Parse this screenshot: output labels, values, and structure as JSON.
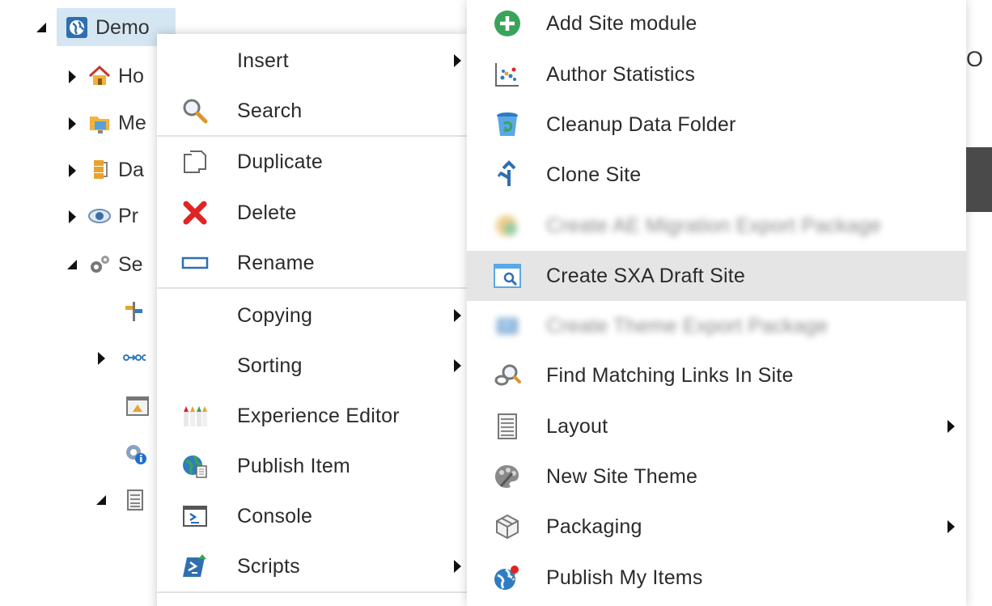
{
  "tree": {
    "root": {
      "label": "Demo",
      "icon": "globe-icon"
    },
    "items": [
      {
        "label": "Ho",
        "icon": "home-icon"
      },
      {
        "label": "Me",
        "icon": "media-folder-icon"
      },
      {
        "label": "Da",
        "icon": "data-icon"
      },
      {
        "label": "Pr",
        "icon": "eye-icon"
      },
      {
        "label": "Se",
        "icon": "settings-gears-icon"
      }
    ]
  },
  "context_menu": {
    "insert": "Insert",
    "search": "Search",
    "duplicate": "Duplicate",
    "delete": "Delete",
    "rename": "Rename",
    "copying": "Copying",
    "sorting": "Sorting",
    "experience_editor": "Experience Editor",
    "publish_item": "Publish Item",
    "console": "Console",
    "scripts": "Scripts"
  },
  "scripts_menu": {
    "add_site_module": "Add Site module",
    "author_statistics": "Author Statistics",
    "cleanup_data_folder": "Cleanup Data Folder",
    "clone_site": "Clone Site",
    "create_ae_migration_export_package": "Create AE Migration Export Package",
    "create_sxa_draft_site": "Create SXA Draft Site",
    "create_theme_export_package": "Create Theme Export Package",
    "find_matching_links_in_site": "Find Matching Links In Site",
    "layout": "Layout",
    "new_site_theme": "New Site Theme",
    "packaging": "Packaging",
    "publish_my_items": "Publish My Items"
  },
  "right_edge": {
    "text": "O"
  },
  "colors": {
    "tree_selection": "#d5e6f3",
    "menu_highlight": "#e5e5e5",
    "accent_blue": "#2f7cc1",
    "delete_red": "#e02424",
    "add_green": "#3aa35b"
  }
}
